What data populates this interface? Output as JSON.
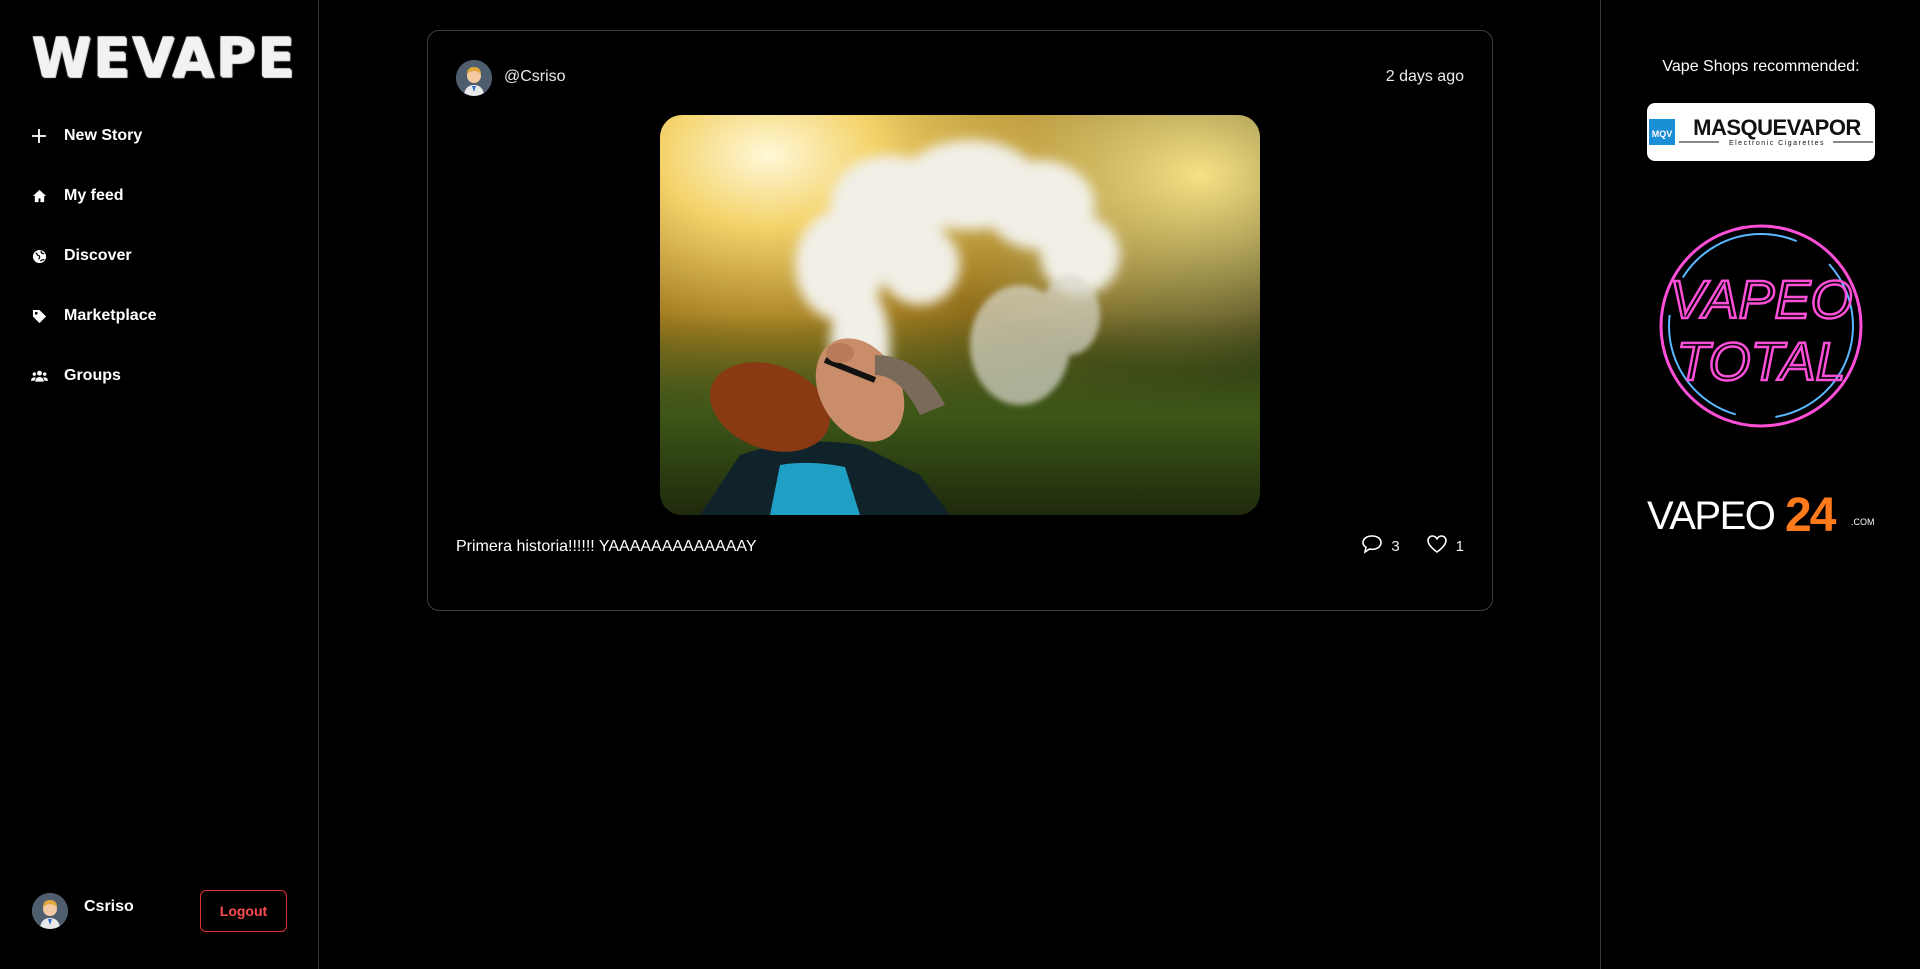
{
  "app": {
    "logo": "WEVAPE"
  },
  "sidebar": {
    "items": [
      {
        "label": "New Story",
        "icon": "plus-icon"
      },
      {
        "label": "My feed",
        "icon": "home-icon"
      },
      {
        "label": "Discover",
        "icon": "globe-icon"
      },
      {
        "label": "Marketplace",
        "icon": "tag-icon"
      },
      {
        "label": "Groups",
        "icon": "users-icon"
      }
    ],
    "user": {
      "name": "Csriso",
      "logout_label": "Logout"
    }
  },
  "feed": {
    "posts": [
      {
        "author": "@Csriso",
        "time": "2 days ago",
        "text": "Primera historia!!!!!! YAAAAAAAAAAAAAY",
        "comments": "3",
        "likes": "1"
      }
    ]
  },
  "right": {
    "title": "Vape Shops recommended:",
    "shops": [
      {
        "name": "MASQUEVAPOR",
        "tagline": "Electronic Cigarettes",
        "badge": "MQV"
      },
      {
        "name": "VAPEO TOTAL",
        "line1": "VAPEO",
        "line2": "TOTAL"
      },
      {
        "name": "VAPEO24",
        "part1": "VAPEO",
        "part2": "24",
        "suffix": ".COM"
      }
    ]
  },
  "colors": {
    "background": "#000000",
    "logout": "#e03131",
    "card_border": "#3c3c48",
    "neon_pink": "#ff4fd8",
    "neon_blue": "#5ab8ff",
    "vapeo24_orange": "#ff7a1a"
  }
}
